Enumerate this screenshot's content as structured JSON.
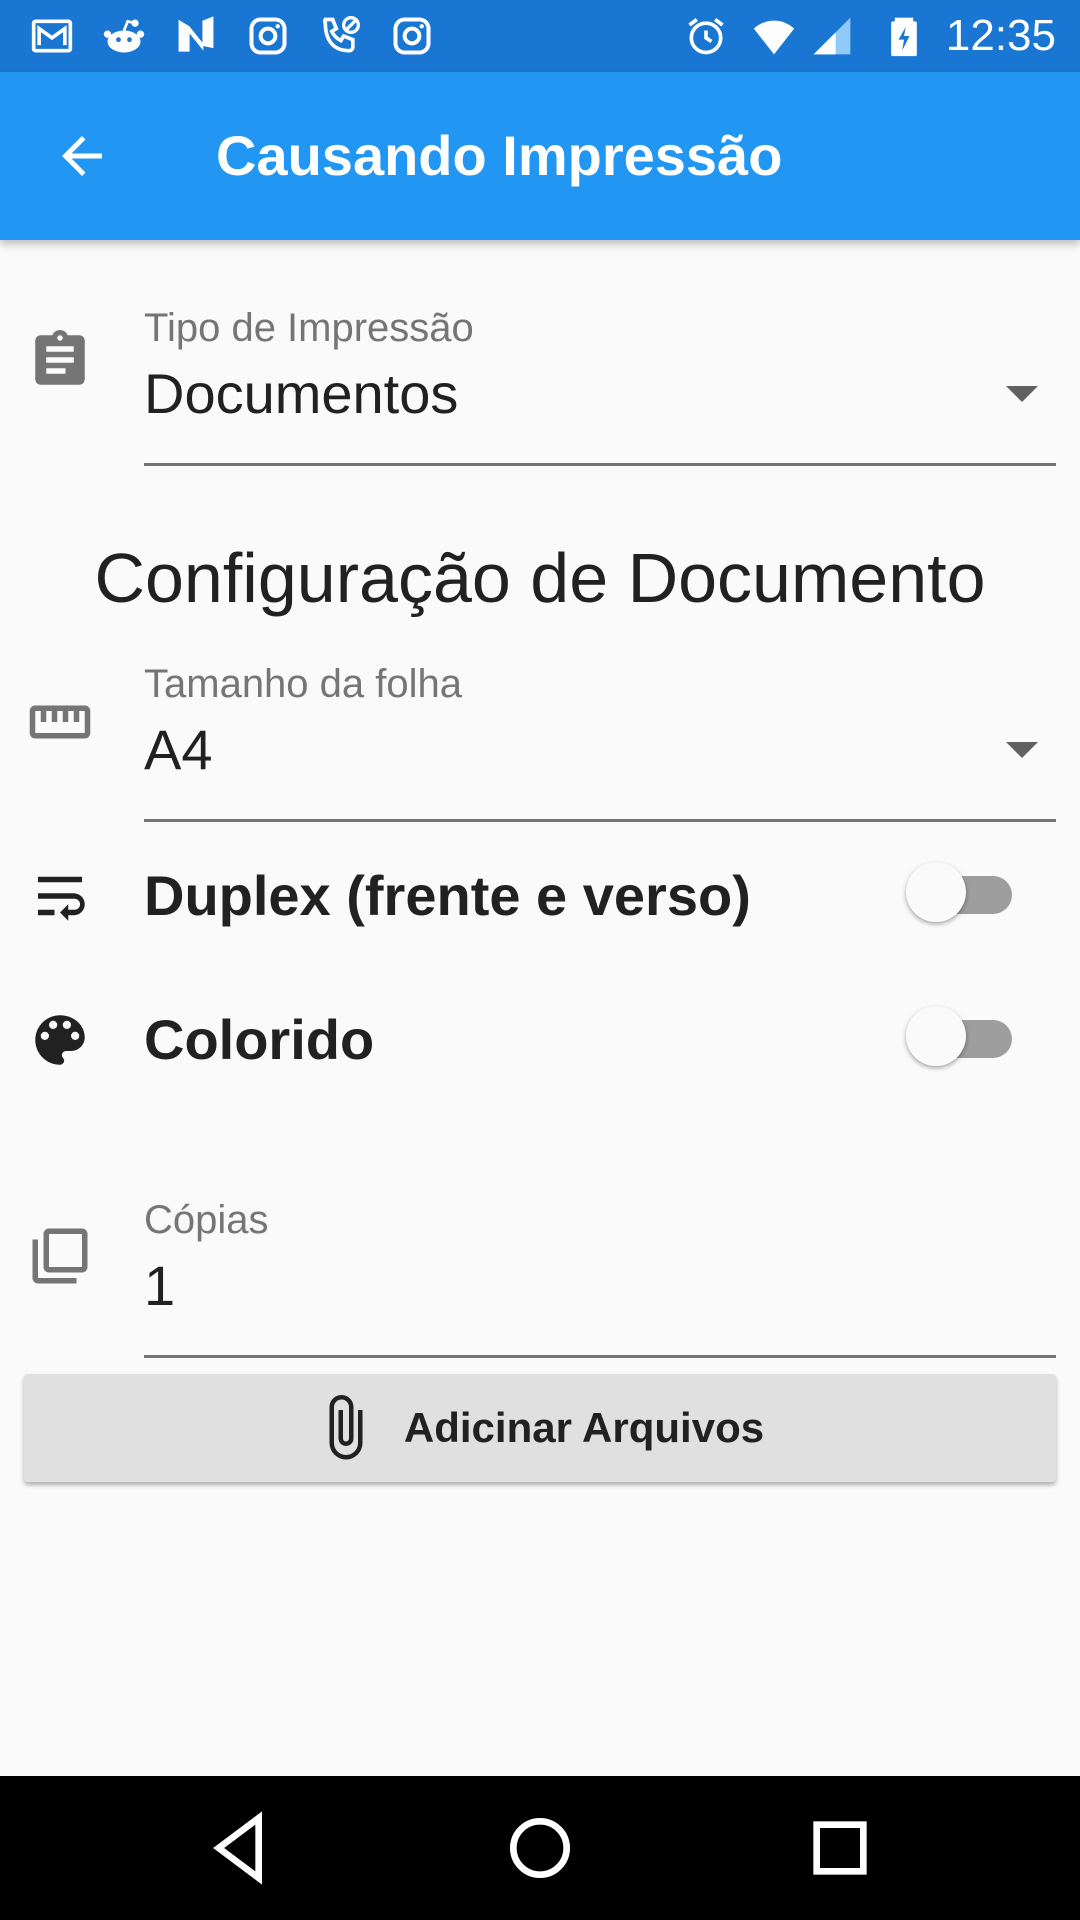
{
  "status_bar": {
    "time": "12:35",
    "notification_icons": [
      "gmail-icon",
      "reddit-icon",
      "n-app-icon",
      "instagram-icon",
      "missed-call-icon",
      "instagram-icon"
    ],
    "system_icons": [
      "alarm-icon",
      "wifi-icon",
      "signal-icon",
      "battery-charging-icon"
    ]
  },
  "app_bar": {
    "title": "Causando Impressão",
    "back_icon": "arrow-back-icon",
    "background": "#2196f3"
  },
  "print_type": {
    "icon": "clipboard-icon",
    "label": "Tipo de Impressão",
    "value": "Documentos"
  },
  "section_title": "Configuração de Documento",
  "sheet_size": {
    "icon": "ruler-icon",
    "label": "Tamanho da folha",
    "value": "A4"
  },
  "duplex": {
    "icon": "wrap-text-icon",
    "label": "Duplex (frente e verso)",
    "enabled": false
  },
  "color": {
    "icon": "palette-icon",
    "label": "Colorido",
    "enabled": false
  },
  "copies": {
    "icon": "copies-icon",
    "label": "Cópias",
    "value": "1"
  },
  "attach_button": {
    "icon": "paperclip-icon",
    "label": "Adicinar Arquivos"
  },
  "nav_bar": {
    "buttons": [
      "back-triangle-icon",
      "home-circle-icon",
      "recents-square-icon"
    ]
  }
}
